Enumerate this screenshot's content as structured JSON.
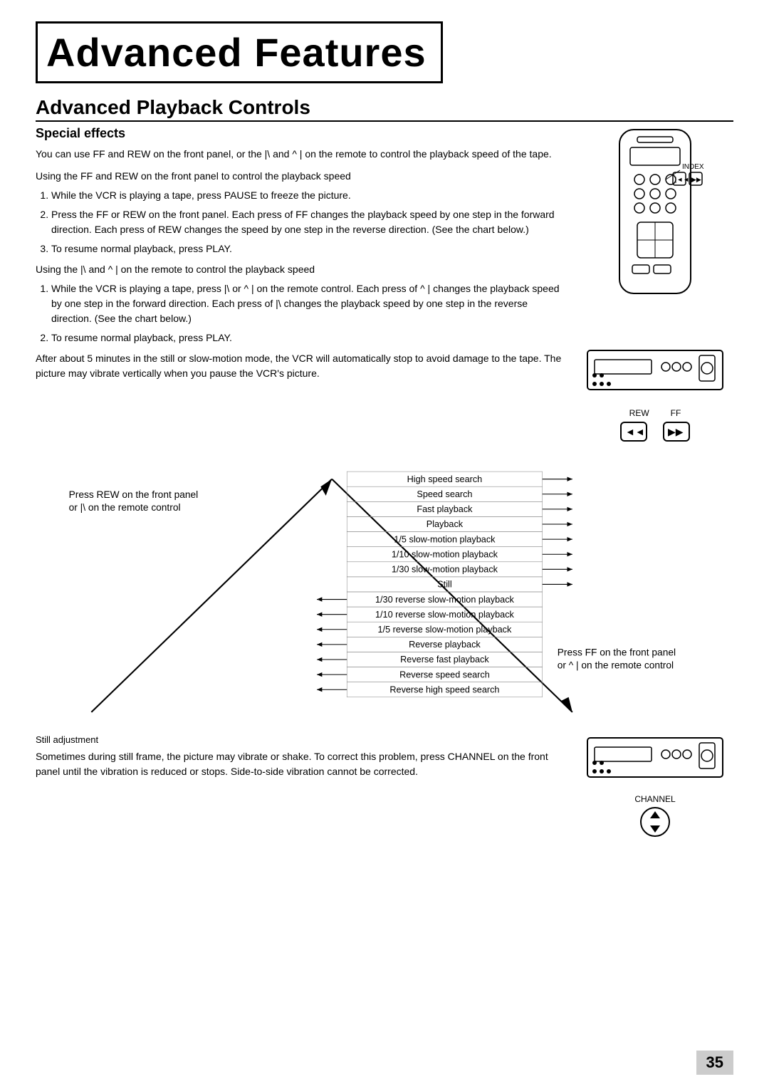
{
  "page": {
    "title": "Advanced Features",
    "section_title": "Advanced Playback Controls",
    "sub_heading": "Special effects",
    "page_number": "35"
  },
  "content": {
    "intro": "You can use FF and REW on the front panel, or the |\\  and ^  | on the remote to control the playback speed of the tape.",
    "front_panel_heading": "Using the FF and REW on the front panel to control the playback speed",
    "front_panel_steps": [
      "While the VCR is playing a tape, press PAUSE to freeze the picture.",
      "Press the FF or REW on the front panel.  Each press of FF changes the playback speed by one step in the forward direction.  Each press of REW changes the speed by one step in the reverse direction.  (See the chart below.)",
      "To resume normal playback, press PLAY."
    ],
    "remote_heading": "Using the |\\  and ^  | on the remote to control the playback speed",
    "remote_steps": [
      "While the VCR is playing a tape, press |\\  or ^  | on the remote control.  Each press of ^  | changes the playback speed by one step in the forward direction.  Each press of |\\ changes the playback speed by one step in the reverse direction.  (See the chart below.)",
      "To resume normal playback, press PLAY."
    ],
    "warning_text": "After about 5 minutes in the still or slow-motion mode, the VCR will automatically stop to avoid damage to the tape.  The picture may vibrate vertically when you pause the VCR's picture.",
    "chart": {
      "left_label_line1": "Press REW on the front panel",
      "left_label_line2": "or |\\   on the remote control",
      "right_label_line1": "Press FF on the front panel",
      "right_label_line2": "or ^   | on the remote control",
      "speeds": [
        "High speed search",
        "Speed search",
        "Fast playback",
        "Playback",
        "1/5 slow-motion playback",
        "1/10 slow-motion playback",
        "1/30 slow-motion playback",
        "Still",
        "1/30 reverse slow-motion playback",
        "1/10 reverse slow-motion playback",
        "1/5 reverse slow-motion playback",
        "Reverse playback",
        "Reverse fast playback",
        "Reverse speed search",
        "Reverse high speed search"
      ]
    },
    "still_adj": {
      "heading": "Still adjustment",
      "text": "Sometimes during still frame, the picture may vibrate or shake.  To correct this problem, press CHANNEL on the front panel until the vibration is reduced or stops.  Side-to-side vibration cannot be corrected."
    },
    "labels": {
      "index": "INDEX",
      "rew": "REW",
      "ff": "FF",
      "channel": "CHANNEL"
    }
  }
}
